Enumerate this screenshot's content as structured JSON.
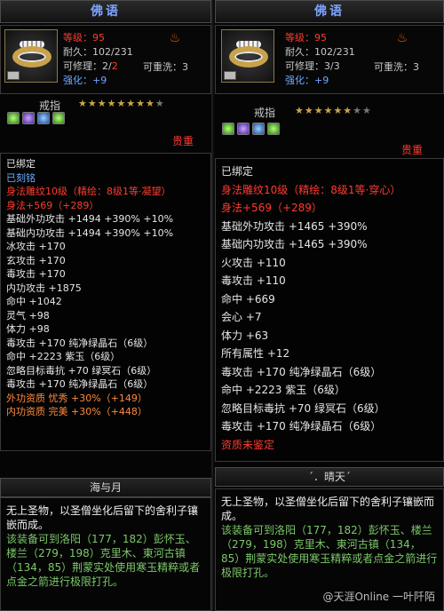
{
  "left": {
    "title": "佛语",
    "stats": {
      "level": "等级：95",
      "durability": "耐久：102/231",
      "repair": "可修理：2/",
      "repair_red": "2",
      "reset": "可重洗：3",
      "enhance": "强化：+9"
    },
    "ring_label": "戒指",
    "stars": "★★★★★★★★",
    "stars_dim": "★",
    "rarity": "贵重",
    "lines": [
      {
        "text": "已绑定",
        "color": "w"
      },
      {
        "text": "已刻铭",
        "color": "b"
      },
      {
        "text": "身法雕纹10级（精绘：8级1等·凝望）",
        "color": "r"
      },
      {
        "text": "身法+569（+289）",
        "color": "r"
      },
      {
        "text": "基础外功攻击 +1494 +390% +10%",
        "color": "w"
      },
      {
        "text": "基础内功攻击 +1494 +390% +10%",
        "color": "w"
      },
      {
        "text": "冰攻击 +170",
        "color": "w"
      },
      {
        "text": "玄攻击 +170",
        "color": "w"
      },
      {
        "text": "毒攻击 +170",
        "color": "w"
      },
      {
        "text": "内功攻击 +1875",
        "color": "w"
      },
      {
        "text": "命中 +1042",
        "color": "w"
      },
      {
        "text": "灵气 +98",
        "color": "w"
      },
      {
        "text": "体力 +98",
        "color": "w"
      },
      {
        "text": "毒攻击 +170 纯净绿晶石（6级）",
        "color": "w"
      },
      {
        "text": "命中 +2223 紫玉（6级）",
        "color": "w"
      },
      {
        "text": "忽略目标毒抗 +70 绿冥石（6级）",
        "color": "w"
      },
      {
        "text": "毒攻击 +170 纯净绿晶石（6级）",
        "color": "w"
      },
      {
        "text": "外功资质 忧秀 +30%（+149）",
        "color": "o"
      },
      {
        "text": "内功资质 完美 +30%（+448）",
        "color": "o"
      }
    ],
    "footer_title": "海与月",
    "desc_white": "无上圣物，以圣僧坐化后留下的舍利子镶嵌而成。",
    "desc_green": "该装备可到洛阳（177，182）彭怀玉、楼兰（279，198）克里木、東河古镇（134，85）荆蒙实处使用寒玉精粹或者点金之箭进行极限打孔。"
  },
  "right": {
    "title": "佛语",
    "stats": {
      "level": "等级：95",
      "durability": "耐久：102/231",
      "repair": "可修理：3/3",
      "reset": "可重洗：3",
      "enhance": "强化：+9"
    },
    "ring_label": "戒指",
    "stars": "★★★★★★",
    "stars_dim": "★★",
    "rarity": "贵重",
    "lines": [
      {
        "text": "已绑定",
        "color": "w"
      },
      {
        "text": "身法雕纹10级（精绘：8级1等·穿心）",
        "color": "r"
      },
      {
        "text": "身法+569（+289）",
        "color": "r"
      },
      {
        "text": "基础外功攻击 +1465 +390%",
        "color": "w"
      },
      {
        "text": "基础内功攻击 +1465 +390%",
        "color": "w"
      },
      {
        "text": "火攻击 +110",
        "color": "w"
      },
      {
        "text": "毒攻击 +110",
        "color": "w"
      },
      {
        "text": "命中 +669",
        "color": "w"
      },
      {
        "text": "会心 +7",
        "color": "w"
      },
      {
        "text": "体力 +63",
        "color": "w"
      },
      {
        "text": "所有属性 +12",
        "color": "w"
      },
      {
        "text": "毒攻击 +170 纯净绿晶石（6级）",
        "color": "w"
      },
      {
        "text": "命中 +2223 紫玉（6级）",
        "color": "w"
      },
      {
        "text": "忽略目标毒抗 +70 绿冥石（6级）",
        "color": "w"
      },
      {
        "text": "毒攻击 +170 纯净绿晶石（6级）",
        "color": "w"
      },
      {
        "text": "资质未鉴定",
        "color": "r"
      }
    ],
    "footer_title": "´．晴天´",
    "desc_white": "无上圣物，以圣僧坐化后留下的舍利子镶嵌而成。",
    "desc_green": "该装备可到洛阳（177，182）彭怀玉、楼兰（279，198）克里木、東河古镇（134，85）荆蒙实处使用寒玉精粹或者点金之箭进行极限打孔。",
    "watermark": "@天涯Online 一叶阡陌"
  }
}
